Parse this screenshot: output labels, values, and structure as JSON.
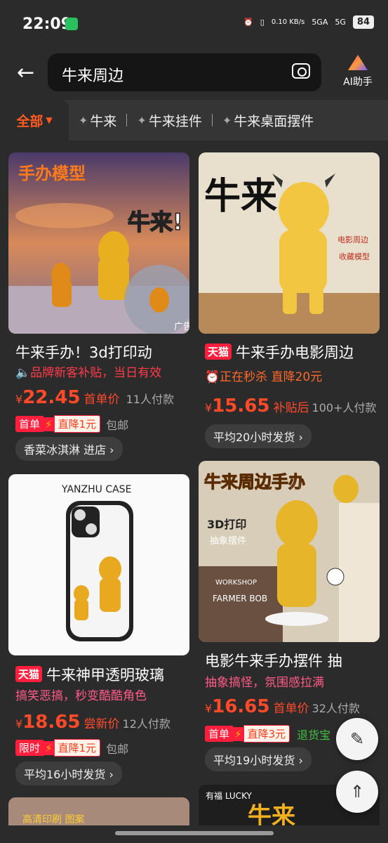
{
  "status_bar": {
    "time": "22:09",
    "speed": "0.10\nKB/s",
    "net1": "5GA",
    "net2": "5G",
    "battery": "84"
  },
  "search": {
    "query": "牛来周边",
    "ai_label": "AI助手"
  },
  "tabs": [
    {
      "label": "全部"
    },
    {
      "label": "牛来"
    },
    {
      "label": "牛来挂件"
    },
    {
      "label": "牛来桌面摆件"
    }
  ],
  "products": [
    {
      "title": "牛来手办！3d打印动",
      "promo": "品牌新客补贴，当日有效",
      "price_int": "22.45",
      "price_tag": "首单价",
      "sold": "11人付款",
      "badge_first": "首单",
      "badge_cut": "直降1元",
      "ship": "包邮",
      "pill": "香菜冰淇淋 进店 ›",
      "img_text": "手办模型",
      "img_text2": "牛来!",
      "ad": "广告"
    },
    {
      "tmall": "天猫",
      "title": "牛来手办电影周边",
      "promo": "正在秒杀 直降20元",
      "price_int": "15.65",
      "price_tag": "补贴后",
      "sold": "100+人付款",
      "pill": "平均20小时发货 ›",
      "img_text": "牛来",
      "img_tag1": "电影周边",
      "img_tag2": "收藏模型"
    },
    {
      "tmall": "天猫",
      "title": "牛来神甲透明玻璃",
      "promo": "搞笑恶搞，秒变酷酷角色",
      "price_int": "18.65",
      "price_tag": "尝新价",
      "sold": "12人付款",
      "badge_first": "限时",
      "badge_cut": "直降1元",
      "ship": "包邮",
      "pill": "平均16小时发货 ›",
      "img_text": "YANZHU CASE"
    },
    {
      "title": "电影牛来手办摆件 抽",
      "promo": "抽象搞怪，氛围感拉满",
      "price_int": "16.65",
      "price_tag": "首单价",
      "sold": "32人付款",
      "badge_first": "首单",
      "badge_cut": "直降3元",
      "extra": "退货宝",
      "pill": "平均19小时发货 ›",
      "img_text": "牛来周边手办",
      "img_tag1": "3D打印",
      "img_tag2": "抽象摆件",
      "img_sign": "FARMER BOB",
      "img_sign2": "WORKSHOP"
    }
  ],
  "bottom_images": {
    "left_text": "高清印刷 图案",
    "right_text": "有福 LUCKY",
    "right_big": "牛来"
  },
  "colors": {
    "accent": "#ff5a1f",
    "price": "#ff4a2a",
    "tmall": "#ff1e3c"
  }
}
